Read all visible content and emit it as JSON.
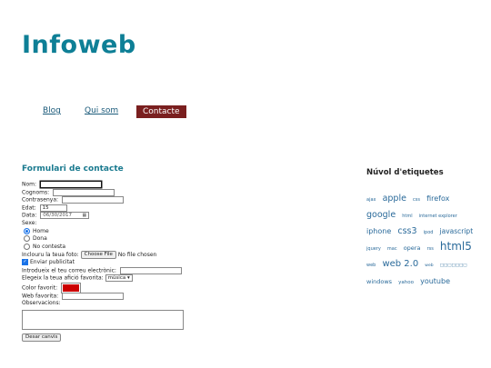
{
  "site": {
    "title": "Infoweb"
  },
  "nav": {
    "items": [
      {
        "label": "Blog"
      },
      {
        "label": "Qui som"
      },
      {
        "label": "Contacte",
        "active": true
      }
    ]
  },
  "form": {
    "heading": "Formulari de contacte",
    "nom_label": "Nom:",
    "cognoms_label": "Cognoms:",
    "contrasenya_label": "Contrasenya:",
    "edat_label": "Edat:",
    "edat_value": "15",
    "data_label": "Data:",
    "data_value": "06/30/2017",
    "sexe_label": "Sexe:",
    "sexe_options": [
      "Home",
      "Dona",
      "No contesta"
    ],
    "sexe_selected": "Home",
    "foto_label": "Inclouru la teua foto:",
    "foto_button": "Choose File",
    "foto_status": "No file chosen",
    "publicitat_label": "Enviar publicitat",
    "publicitat_checked": true,
    "email_label": "Introdueix el teu correu electrònic:",
    "aficio_label": "Elegeix la teua afició favorita:",
    "aficio_value": "música",
    "color_label": "Color favorit:",
    "color_value": "#cc0000",
    "web_label": "Web favorita:",
    "observacions_label": "Observacions:",
    "reset_button": "Desar canvis"
  },
  "tagcloud": {
    "heading": "Núvol d'etiquetes",
    "tags": [
      {
        "label": "ajax",
        "size": 5
      },
      {
        "label": "apple",
        "size": 9.5
      },
      {
        "label": "css",
        "size": 5
      },
      {
        "label": "firefox",
        "size": 8
      },
      {
        "label": "google",
        "size": 9.5
      },
      {
        "label": "html",
        "size": 5
      },
      {
        "label": "internet explorer",
        "size": 5
      },
      {
        "label": "iphone",
        "size": 8
      },
      {
        "label": "css3",
        "size": 9.5
      },
      {
        "label": "ipod",
        "size": 5
      },
      {
        "label": "javascript",
        "size": 7.5
      },
      {
        "label": "jquery",
        "size": 5
      },
      {
        "label": "mac",
        "size": 5
      },
      {
        "label": "opera",
        "size": 6.5
      },
      {
        "label": "rss",
        "size": 5
      },
      {
        "label": "html5",
        "size": 12
      },
      {
        "label": "web",
        "size": 5
      },
      {
        "label": "web 2.0",
        "size": 10
      },
      {
        "label": "web",
        "size": 4.5
      },
      {
        "label": "□□□□□□□",
        "size": 4.5
      },
      {
        "label": "windows",
        "size": 6.5
      },
      {
        "label": "yahoo",
        "size": 5.5
      },
      {
        "label": "youtube",
        "size": 8
      }
    ]
  }
}
